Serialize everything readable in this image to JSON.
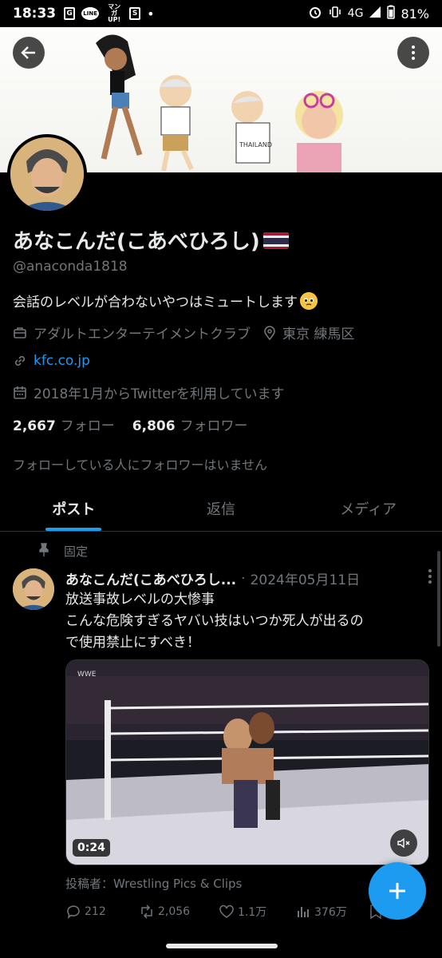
{
  "status_bar": {
    "time": "18:33",
    "app_icons": [
      "G",
      "LINE",
      "マンガUP!",
      "S",
      "•"
    ],
    "network": "4G",
    "battery": "81%"
  },
  "profile": {
    "display_name": "あなこんだ(こあべひろし)",
    "handle": "@anaconda1818",
    "bio": "会話のレベルが合わないやつはミュートします",
    "category": "アダルトエンターテイメントクラブ",
    "location": "東京 練馬区",
    "website": "kfc.co.jp",
    "joined": "2018年1月からTwitterを利用しています",
    "following_count": "2,667",
    "following_label": "フォロー",
    "followers_count": "6,806",
    "followers_label": "フォロワー",
    "no_mutual_followers": "フォローしている人にフォロワーはいません"
  },
  "tabs": [
    {
      "label": "ポスト",
      "active": true
    },
    {
      "label": "返信",
      "active": false
    },
    {
      "label": "メディア",
      "active": false
    }
  ],
  "post": {
    "pinned_label": "固定",
    "author": "あなこんだ(こあべひろし...",
    "separator": "·",
    "date": "2024年05月11日",
    "text_lines": [
      "放送事故レベルの大惨事",
      "こんな危険すぎるヤバい技はいつか死人が出るの",
      "で使用禁止にすべき！"
    ],
    "video_duration": "0:24",
    "poster": "投稿者：Wrestling Pics & Clips",
    "replies": "212",
    "reposts": "2,056",
    "likes": "1.1万",
    "views": "376万"
  },
  "colors": {
    "accent": "#1d9bf0",
    "background": "#000000",
    "secondary_text": "#71767b"
  }
}
